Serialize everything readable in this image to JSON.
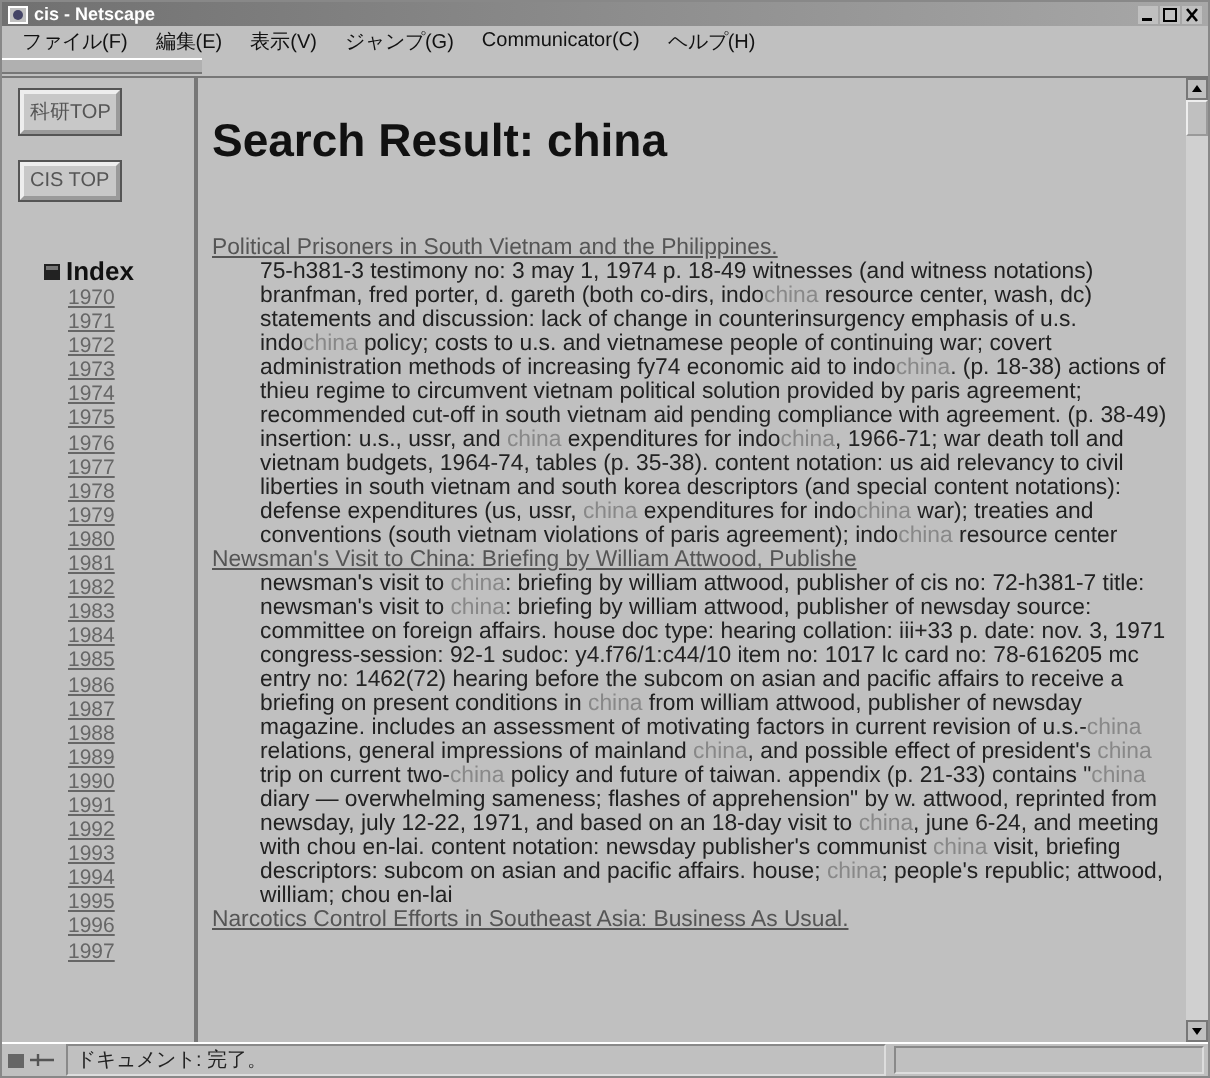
{
  "window": {
    "title": "cis - Netscape"
  },
  "menu": [
    "ファイル(F)",
    "編集(E)",
    "表示(V)",
    "ジャンプ(G)",
    "Communicator(C)",
    "ヘルプ(H)"
  ],
  "sidebar": {
    "buttons": [
      "科研TOP",
      "CIS TOP"
    ],
    "index_title": "Index",
    "years": [
      "1970",
      "1971",
      "1972",
      "1973",
      "1974",
      "1975",
      "1976",
      "1977",
      "1978",
      "1979",
      "1980",
      "1981",
      "1982",
      "1983",
      "1984",
      "1985",
      "1986",
      "1987",
      "1988",
      "1989",
      "1990",
      "1991",
      "1992",
      "1993",
      "1994",
      "1995",
      "1996",
      "1997"
    ]
  },
  "heading": "Search Result: china",
  "results": [
    {
      "title": "Political Prisoners in South Vietnam and the Philippines.",
      "parts": [
        {
          "text": "75-h381-3 testimony no: 3 may 1, 1974 p. 18-49 witnesses (and witness notations) branfman, fred porter, d. gareth (both co-dirs, indo",
          "hit": false
        },
        {
          "text": "china",
          "hit": true
        },
        {
          "text": " resource center, wash, dc) statements and discussion: lack of change in counterinsurgency emphasis of u.s. indo",
          "hit": false
        },
        {
          "text": "china",
          "hit": true
        },
        {
          "text": " policy; costs to u.s. and vietnamese people of continuing war; covert administration methods of increasing fy74 economic aid to indo",
          "hit": false
        },
        {
          "text": "china",
          "hit": true
        },
        {
          "text": ". (p. 18-38) actions of thieu regime to circumvent vietnam political solution provided by paris agreement; recommended cut-off in south vietnam aid pending compliance with agreement. (p. 38-49) insertion: u.s., ussr, and ",
          "hit": false
        },
        {
          "text": "china",
          "hit": true
        },
        {
          "text": " expenditures for indo",
          "hit": false
        },
        {
          "text": "china",
          "hit": true
        },
        {
          "text": ", 1966-71; war death toll and vietnam budgets, 1964-74, tables (p. 35-38). content notation: us aid relevancy to civil liberties in south vietnam and south korea descriptors (and special content notations): defense expenditures (us, ussr, ",
          "hit": false
        },
        {
          "text": "china",
          "hit": true
        },
        {
          "text": " expenditures for indo",
          "hit": false
        },
        {
          "text": "china",
          "hit": true
        },
        {
          "text": " war); treaties and conventions (south vietnam violations of paris agreement); indo",
          "hit": false
        },
        {
          "text": "china",
          "hit": true
        },
        {
          "text": " resource center",
          "hit": false
        }
      ]
    },
    {
      "title": "Newsman's Visit to China: Briefing by William Attwood, Publishe",
      "parts": [
        {
          "text": "newsman's visit to ",
          "hit": false
        },
        {
          "text": "china",
          "hit": true
        },
        {
          "text": ": briefing by william attwood, publisher of cis no: 72-h381-7 title: newsman's visit to ",
          "hit": false
        },
        {
          "text": "china",
          "hit": true
        },
        {
          "text": ": briefing by william attwood, publisher of newsday source: committee on foreign affairs. house doc type: hearing collation: iii+33 p. date: nov. 3, 1971 congress-session: 92-1 sudoc: y4.f76/1:c44/10 item no: 1017 lc card no: 78-616205 mc entry no: 1462(72) hearing before the subcom on asian and pacific affairs to receive a briefing on present conditions in ",
          "hit": false
        },
        {
          "text": "china",
          "hit": true
        },
        {
          "text": " from william attwood, publisher of newsday magazine. includes an assessment of motivating factors in current revision of u.s.-",
          "hit": false
        },
        {
          "text": "china",
          "hit": true
        },
        {
          "text": " relations, general impressions of mainland ",
          "hit": false
        },
        {
          "text": "china",
          "hit": true
        },
        {
          "text": ", and possible effect of president's ",
          "hit": false
        },
        {
          "text": "china",
          "hit": true
        },
        {
          "text": " trip on current two-",
          "hit": false
        },
        {
          "text": "china",
          "hit": true
        },
        {
          "text": " policy and future of taiwan. appendix (p. 21-33) contains \"",
          "hit": false
        },
        {
          "text": "china",
          "hit": true
        },
        {
          "text": " diary — overwhelming sameness; flashes of apprehension\" by w. attwood, reprinted from newsday, july 12-22, 1971, and based on an 18-day visit to ",
          "hit": false
        },
        {
          "text": "china",
          "hit": true
        },
        {
          "text": ", june 6-24, and meeting with chou en-lai. content notation: newsday publisher's communist ",
          "hit": false
        },
        {
          "text": "china",
          "hit": true
        },
        {
          "text": " visit, briefing descriptors: subcom on asian and pacific affairs. house; ",
          "hit": false
        },
        {
          "text": "china",
          "hit": true
        },
        {
          "text": "; people's republic; attwood, william; chou en-lai",
          "hit": false
        }
      ]
    },
    {
      "title": "Narcotics Control Efforts in Southeast Asia: Business As Usual."
    }
  ],
  "status_bar": {
    "text": "ドキュメント: 完了。"
  }
}
